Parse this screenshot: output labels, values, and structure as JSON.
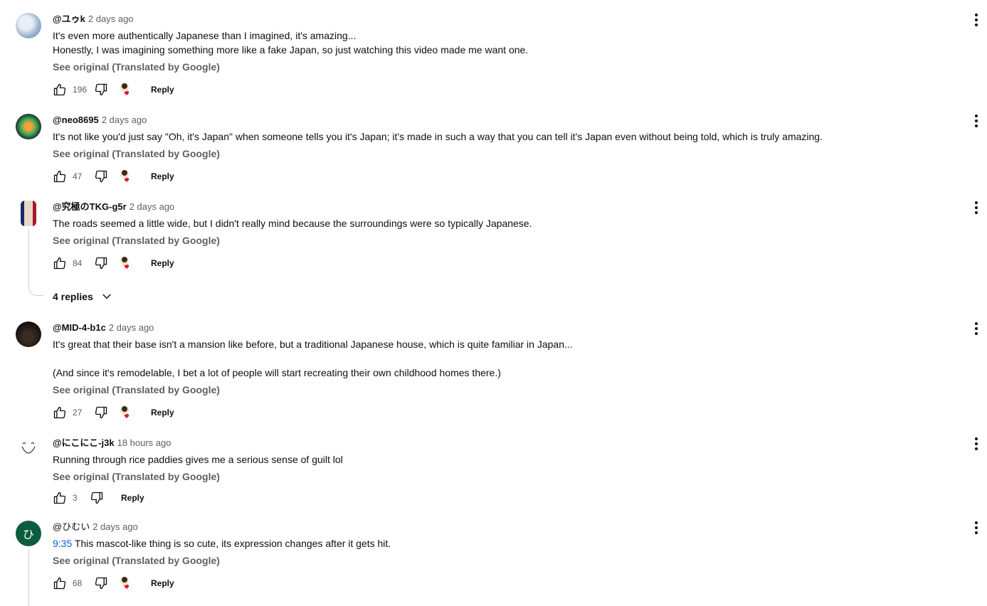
{
  "comments": [
    {
      "author": "@ユゥk",
      "time": "2 days ago",
      "lines": [
        "It's even more authentically Japanese than I imagined, it's amazing...",
        "Honestly, I was imagining something more like a fake Japan, so just watching this video made me want one."
      ],
      "see_original": "See original (Translated by Google)",
      "likes": "196",
      "reply": "Reply"
    },
    {
      "author": "@neo8695",
      "time": "2 days ago",
      "lines": [
        "It's not like you'd just say \"Oh, it's Japan\" when someone tells you it's Japan; it's made in such a way that you can tell it's Japan even without being told, which is truly amazing."
      ],
      "see_original": "See original (Translated by Google)",
      "likes": "47",
      "reply": "Reply"
    },
    {
      "author": "@究極のTKG-g5r",
      "time": "2 days ago",
      "lines": [
        "The roads seemed a little wide, but I didn't really mind because the surroundings were so typically Japanese."
      ],
      "see_original": "See original (Translated by Google)",
      "likes": "84",
      "reply": "Reply",
      "replies_label": "4 replies"
    },
    {
      "author": "@MID-4-b1c",
      "time": "2 days ago",
      "lines": [
        "It's great that their base isn't a mansion like before, but a traditional Japanese house, which is quite familiar in Japan...",
        "",
        "(And since it's remodelable, I bet a lot of people will start recreating their own childhood homes there.)"
      ],
      "see_original": "See original (Translated by Google)",
      "likes": "27",
      "reply": "Reply"
    },
    {
      "author": "@にこにこ-j3k",
      "time": "18 hours ago",
      "lines": [
        "Running through rice paddies gives me a serious sense of guilt lol"
      ],
      "see_original": "See original (Translated by Google)",
      "likes": "3",
      "reply": "Reply"
    },
    {
      "author": "@ひむい",
      "time": "2 days ago",
      "timestamp_link": "9:35",
      "lines": [
        "This mascot-like thing is so cute, its expression changes after it gets hit."
      ],
      "see_original": "See original (Translated by Google)",
      "likes": "68",
      "reply": "Reply",
      "avatar_letter": "ひ"
    }
  ],
  "colors": {
    "link": "#065fd4",
    "muted": "#606060",
    "avatar_green": "#0b5d3e",
    "heart": "#e0102a"
  },
  "icons": [
    "thumb-up-icon",
    "thumb-down-icon",
    "creator-heart-icon",
    "more-vert-icon",
    "chevron-down-icon"
  ]
}
